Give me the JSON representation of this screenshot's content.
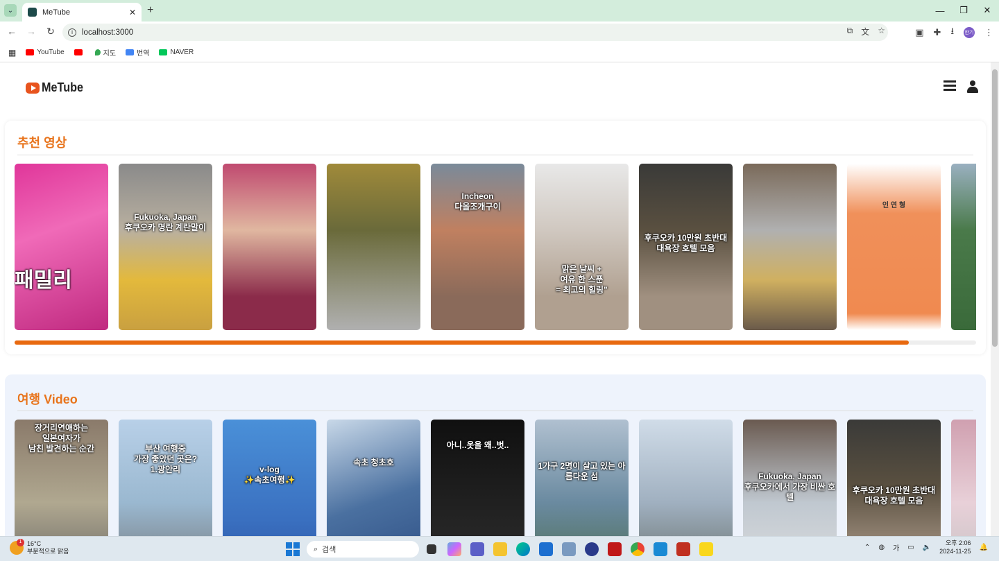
{
  "browser": {
    "tab_title": "MeTube",
    "url": "localhost:3000",
    "bookmarks": [
      {
        "label": "YouTube",
        "color": "#ff0000"
      },
      {
        "label": "",
        "color": "#ff0000"
      },
      {
        "label": "지도",
        "color": "#34a853"
      },
      {
        "label": "번역",
        "color": "#4285f4"
      },
      {
        "label": "NAVER",
        "color": "#03c75a"
      }
    ]
  },
  "app": {
    "logo_text": "MeTube",
    "accent_color": "#e8741c"
  },
  "sections": [
    {
      "title": "추천 영상",
      "progress": 0.93,
      "cards": [
        {
          "caption": "패밀리",
          "bg": "linear-gradient(160deg,#e0369a,#f06ab8 40%,#c02a80)"
        },
        {
          "caption": "Fukuoka, Japan\n후쿠오카 명란 계란말이",
          "bg": "linear-gradient(180deg,#8a8a8a,#b9b0a0 40%,#e3b93c 70%,#c9a040)"
        },
        {
          "caption": "",
          "bg": "linear-gradient(180deg,#c04a70,#e0b7a0 40%,#8b2b4a 80%)"
        },
        {
          "caption": "",
          "bg": "linear-gradient(180deg,#a08a3a,#6a6a3a 40%,#9a9a8a 80%,#b0b0b0)"
        },
        {
          "caption": "Incheon\n다올조개구이",
          "bg": "linear-gradient(180deg,#7a8a9a,#c08060 40%,#8a6a5a 80%)"
        },
        {
          "caption": "맑은 날씨 +\n여유 한 스푼\n= 최고의 힐링\"",
          "bg": "linear-gradient(180deg,#e8e8e8,#d0c8c0 40%,#b0a090 80%)"
        },
        {
          "caption": "후쿠오카 10만원 초반대\n대욕장 호텔 모음",
          "bg": "linear-gradient(180deg,#3a3a38,#5a5040 40%,#a09080 80%)"
        },
        {
          "caption": "",
          "bg": "linear-gradient(180deg,#7a6a5a,#b0b0b0 40%,#d0b060 70%,#6a5a4a)"
        },
        {
          "caption": "인 연 형",
          "bg": "linear-gradient(180deg,#fff 0,#f0905a 30%,#f08a50 90%,#fff)"
        },
        {
          "caption": "",
          "bg": "linear-gradient(180deg,#9ab0c0,#4a7a4a 40%,#3a6a3a)"
        }
      ]
    },
    {
      "title": "여행 Video",
      "cards": [
        {
          "caption": "장거리연애하는\n일본여자가\n남친 발견하는 순간",
          "bg": "linear-gradient(180deg,#8a7a6a,#b0a890 50%,#606060)"
        },
        {
          "caption": "부산 여행중\n가장 좋았던 곳은?\n1.광안리",
          "bg": "linear-gradient(180deg,#b8d0e8,#9ab8d0 50%,#707070)"
        },
        {
          "caption": "v-log\n✨속초여행✨",
          "bg": "linear-gradient(180deg,#4a90d8,#3a70c0 60%,#2a50a0)"
        },
        {
          "caption": "속초 청초호",
          "bg": "linear-gradient(160deg,#c8d8e8,#4a70a0 50%,#2a4a80)"
        },
        {
          "caption": "아니..옷을 왜..벗..",
          "bg": "linear-gradient(180deg,#101010,#202020 50%,#303030)"
        },
        {
          "caption": "1가구 2명이 살고 있는 아름다운 섬",
          "bg": "linear-gradient(180deg,#b0c0d0,#6a8aa0 50%,#4a6a4a)"
        },
        {
          "caption": "",
          "bg": "linear-gradient(180deg,#d0dce8,#a0b0c0 50%,#606860)"
        },
        {
          "caption": "Fukuoka, Japan\n후쿠오카에서 가장 비싼 호텔",
          "bg": "linear-gradient(180deg,#6a5a50,#c0c8d0 50%,#e0e0e0)"
        },
        {
          "caption": "후쿠오카 10만원 초반대\n대욕장 호텔 모음",
          "bg": "linear-gradient(180deg,#3a3a38,#5a5040 40%,#a09080 80%)"
        },
        {
          "caption": "",
          "bg": "linear-gradient(180deg,#d0a0b0,#e8d0d8 50%,#c0c0c0)"
        }
      ]
    }
  ],
  "taskbar": {
    "weather_temp": "16°C",
    "weather_desc": "부분적으로 맑음",
    "weather_badge": "1",
    "search_placeholder": "검색",
    "ime": "가",
    "time": "오후 2:06",
    "date": "2024-11-25",
    "profile_initials": "한기"
  }
}
